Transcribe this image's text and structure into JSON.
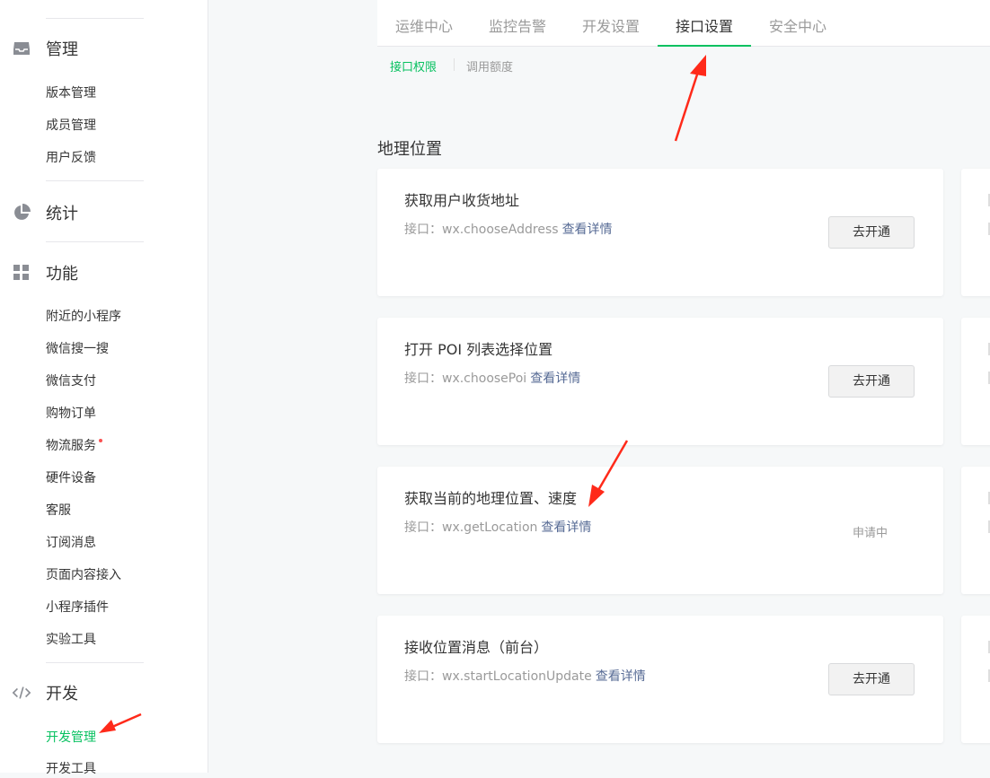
{
  "sidebar": {
    "groups": [
      {
        "icon": "inbox-icon",
        "label": "管理",
        "items": [
          "版本管理",
          "成员管理",
          "用户反馈"
        ]
      },
      {
        "icon": "pie-chart-icon",
        "label": "统计",
        "items": []
      },
      {
        "icon": "grid-icon",
        "label": "功能",
        "items": [
          "附近的小程序",
          "微信搜一搜",
          "微信支付",
          "购物订单",
          "物流服务",
          "硬件设备",
          "客服",
          "订阅消息",
          "页面内容接入",
          "小程序插件",
          "实验工具"
        ]
      },
      {
        "icon": "code-icon",
        "label": "开发",
        "items": [
          "开发管理",
          "开发工具"
        ]
      }
    ],
    "active_item": "开发管理",
    "badge_item": "物流服务"
  },
  "tabs": [
    "运维中心",
    "监控告警",
    "开发设置",
    "接口设置",
    "安全中心"
  ],
  "active_tab": "接口设置",
  "subtabs": [
    "接口权限",
    "调用额度"
  ],
  "active_subtab": "接口权限",
  "section": {
    "title": "地理位置"
  },
  "cards": [
    {
      "title": "获取用户收货地址",
      "api_prefix": "接口：",
      "api": "wx.chooseAddress",
      "detail": "查看详情",
      "action": "去开通",
      "status": ""
    },
    {
      "title": "打开 POI 列表选择位置",
      "api_prefix": "接口：",
      "api": "wx.choosePoi",
      "detail": "查看详情",
      "action": "去开通",
      "status": ""
    },
    {
      "title": "获取当前的地理位置、速度",
      "api_prefix": "接口：",
      "api": "wx.getLocation",
      "detail": "查看详情",
      "action": "",
      "status": "申请中"
    },
    {
      "title": "接收位置消息（前台）",
      "api_prefix": "接口：",
      "api": "wx.startLocationUpdate",
      "detail": "查看详情",
      "action": "去开通",
      "status": ""
    }
  ],
  "colors": {
    "accent": "#07c160",
    "link": "#576b95",
    "annotation_arrow": "#ff2a1a",
    "badge": "#fa5151"
  }
}
